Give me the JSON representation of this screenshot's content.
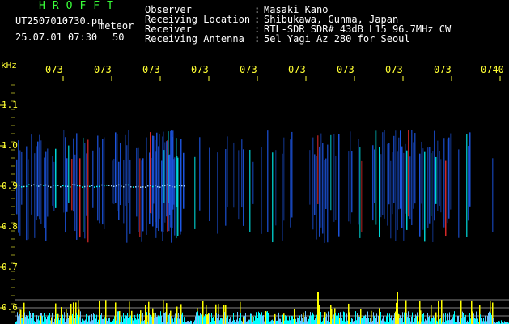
{
  "header": {
    "title": "HROFFT",
    "filename": "UT2507010730.pn",
    "mode": "meteor",
    "datetime": "25.07.01 07:30",
    "count": "50"
  },
  "meta": {
    "observer_label": "Observer",
    "observer_value": "Masaki Kano",
    "location_label": "Receiving Location",
    "location_value": "Shibukawa, Gunma, Japan",
    "receiver_label": "Receiver",
    "receiver_value": "RTL-SDR SDR# 43dB L15 96.7MHz CW",
    "antenna_label": "Receiving Antenna",
    "antenna_value": "5el Yagi Az 280 for Seoul",
    "separator": ":"
  },
  "axis": {
    "unit": "kHz",
    "y_ticks": [
      "1.1",
      "1.0",
      "0.9",
      "0.8",
      "0.7",
      "0.6"
    ],
    "x_ticks": [
      "073",
      "073",
      "073",
      "073",
      "073",
      "073",
      "073",
      "073",
      "073",
      "0740"
    ]
  },
  "colors": {
    "text_green": "#39ff39",
    "text_white": "#ffffff",
    "tick_yellow": "#ffff33",
    "echo_blue": "#2060ff",
    "echo_cyan": "#00ffff",
    "echo_red": "#ff3030",
    "activity_yellow": "#ffff00"
  }
}
